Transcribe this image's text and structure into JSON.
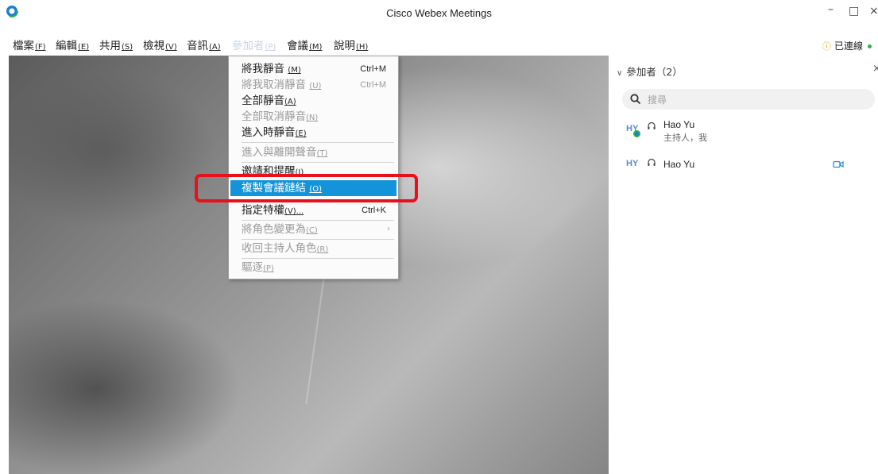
{
  "window": {
    "title": "Cisco Webex Meetings"
  },
  "menubar": {
    "items": [
      {
        "label": "檔案",
        "mnemonic": "(F)"
      },
      {
        "label": "編輯",
        "mnemonic": "(E)"
      },
      {
        "label": "共用",
        "mnemonic": "(S)"
      },
      {
        "label": "檢視",
        "mnemonic": "(V)"
      },
      {
        "label": "音訊",
        "mnemonic": "(A)"
      },
      {
        "label": "參加者",
        "mnemonic": "(P)"
      },
      {
        "label": "會議",
        "mnemonic": "(M)"
      },
      {
        "label": "說明",
        "mnemonic": "(H)"
      }
    ],
    "active_index": 5,
    "connection": "已連線"
  },
  "dropdown": {
    "items": [
      {
        "label": "將我靜音 ",
        "mnemonic": "(M)",
        "shortcut": "Ctrl+M",
        "enabled": true
      },
      {
        "label": "將我取消靜音 ",
        "mnemonic": "(U)",
        "shortcut": "Ctrl+M",
        "enabled": false
      },
      {
        "label": "全部靜音",
        "mnemonic": "(A)",
        "shortcut": "",
        "enabled": true
      },
      {
        "label": "全部取消靜音",
        "mnemonic": "(N)",
        "shortcut": "",
        "enabled": false
      },
      {
        "label": "進入時靜音",
        "mnemonic": "(E)",
        "shortcut": "",
        "enabled": true
      },
      {
        "label": "進入與離開聲音",
        "mnemonic": "(T)",
        "shortcut": "",
        "enabled": false
      },
      {
        "label": "邀請和提醒",
        "mnemonic": "(I)",
        "shortcut": "",
        "enabled": true
      },
      {
        "label": "複製會議鏈結 ",
        "mnemonic": "(O)",
        "shortcut": "",
        "enabled": true,
        "highlighted": true
      },
      {
        "label": "指定特權",
        "mnemonic": "(V)...",
        "shortcut": "Ctrl+K",
        "enabled": true
      },
      {
        "label": "將角色變更為",
        "mnemonic": "(C)",
        "shortcut": "",
        "enabled": false,
        "submenu": true
      },
      {
        "label": "收回主持人角色",
        "mnemonic": "(R)",
        "shortcut": "",
        "enabled": false
      },
      {
        "label": "驅逐",
        "mnemonic": "(P)",
        "shortcut": "",
        "enabled": false
      }
    ]
  },
  "panel": {
    "title": "參加者（2）",
    "search_placeholder": "搜尋",
    "participants": [
      {
        "initials": "HY",
        "name": "Hao Yu",
        "role": "主持人，我"
      },
      {
        "initials": "HY",
        "name": "Hao Yu",
        "role": ""
      }
    ]
  },
  "colors": {
    "highlight": "#1393d9",
    "annotation_box": "#e8101a",
    "connected": "#2bb14a"
  }
}
